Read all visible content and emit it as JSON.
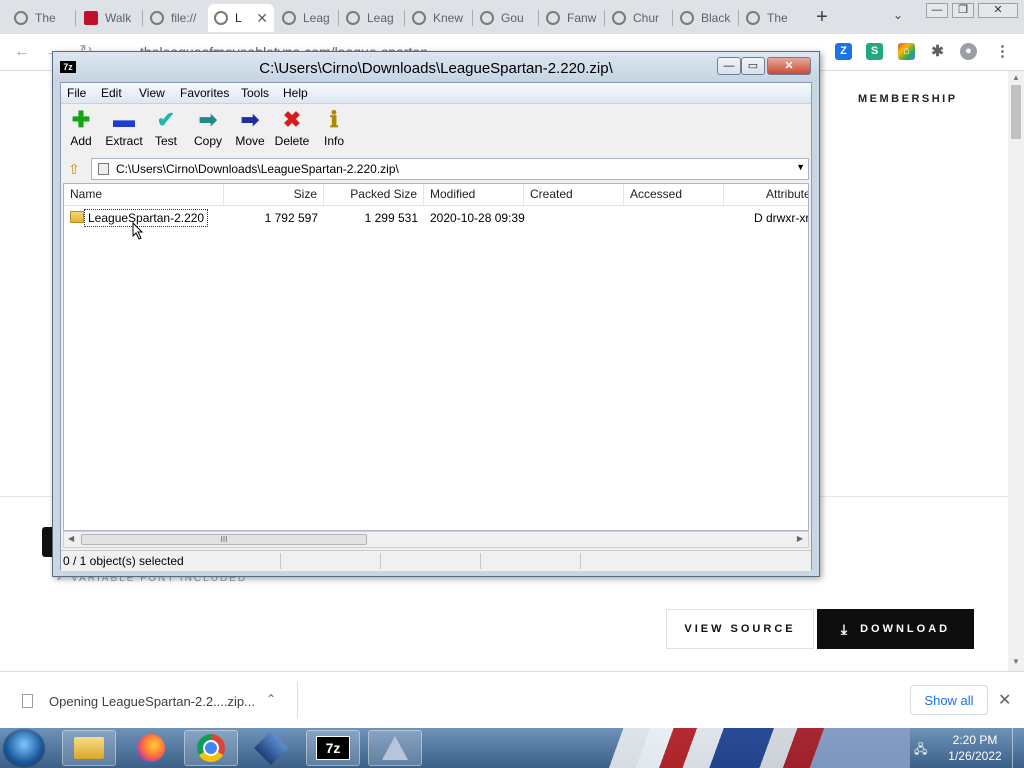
{
  "browser": {
    "tabs": [
      {
        "label": "The",
        "favicon": "globe-icon",
        "active": false
      },
      {
        "label": "Walk",
        "favicon": "red-logo-icon",
        "active": false
      },
      {
        "label": "file://",
        "favicon": "globe-icon",
        "active": false
      },
      {
        "label": "L",
        "favicon": "globe-icon",
        "active": true
      },
      {
        "label": "Leag",
        "favicon": "globe-icon",
        "active": false
      },
      {
        "label": "Leag",
        "favicon": "globe-icon",
        "active": false
      },
      {
        "label": "Knew",
        "favicon": "globe-icon",
        "active": false
      },
      {
        "label": "Gou",
        "favicon": "globe-icon",
        "active": false
      },
      {
        "label": "Fanw",
        "favicon": "globe-icon",
        "active": false
      },
      {
        "label": "Chur",
        "favicon": "globe-icon",
        "active": false
      },
      {
        "label": "Black",
        "favicon": "globe-icon",
        "active": false
      },
      {
        "label": "The",
        "favicon": "globe-icon",
        "active": false
      }
    ],
    "new_tab": "+",
    "tab_search": "⌄",
    "url": "theleagueofmoveabletype.com/league-spartan",
    "window_controls": {
      "minimize": "—",
      "restore": "❐",
      "close": "✕"
    }
  },
  "page": {
    "membership": "MEMBERSHIP",
    "variable_font_note": "VARIABLE FONT INCLUDED",
    "view_source": "VIEW SOURCE",
    "download": "DOWNLOAD"
  },
  "download_shelf": {
    "item_text": "Opening LeagueSpartan-2.2....zip...",
    "show_all": "Show all",
    "close": "✕"
  },
  "taskbar": {
    "time": "2:20 PM",
    "date": "1/26/2022",
    "items": [
      "file-explorer-icon",
      "firefox-icon",
      "chrome-icon",
      "virtualbox-icon",
      "7zip-icon",
      "app-icon"
    ]
  },
  "sevenzip": {
    "app_icon_text": "7z",
    "title": "C:\\Users\\Cirno\\Downloads\\LeagueSpartan-2.220.zip\\",
    "menu": [
      "File",
      "Edit",
      "View",
      "Favorites",
      "Tools",
      "Help"
    ],
    "toolbar": [
      {
        "label": "Add",
        "icon": "add-icon",
        "glyph": "✚",
        "color": "#16a316"
      },
      {
        "label": "Extract",
        "icon": "extract-icon",
        "glyph": "▬",
        "color": "#1f3bd2"
      },
      {
        "label": "Test",
        "icon": "test-icon",
        "glyph": "✔",
        "color": "#1fb7b0"
      },
      {
        "label": "Copy",
        "icon": "copy-icon",
        "glyph": "➡",
        "color": "#1f8a8a"
      },
      {
        "label": "Move",
        "icon": "move-icon",
        "glyph": "➡",
        "color": "#1c2f9b"
      },
      {
        "label": "Delete",
        "icon": "delete-icon",
        "glyph": "✖",
        "color": "#d81b1b"
      },
      {
        "label": "Info",
        "icon": "info-icon",
        "glyph": "ℹ",
        "color": "#b08a00"
      }
    ],
    "address": "C:\\Users\\Cirno\\Downloads\\LeagueSpartan-2.220.zip\\",
    "columns": [
      "Name",
      "Size",
      "Packed Size",
      "Modified",
      "Created",
      "Accessed",
      "Attribute"
    ],
    "rows": [
      {
        "name": "LeagueSpartan-2.220",
        "size": "1 792 597",
        "packed_size": "1 299 531",
        "modified": "2020-10-28 09:39",
        "created": "",
        "accessed": "",
        "attributes": "D drwxr-xr-"
      }
    ],
    "status": "0 / 1 object(s) selected",
    "scroll_grip": "III"
  }
}
